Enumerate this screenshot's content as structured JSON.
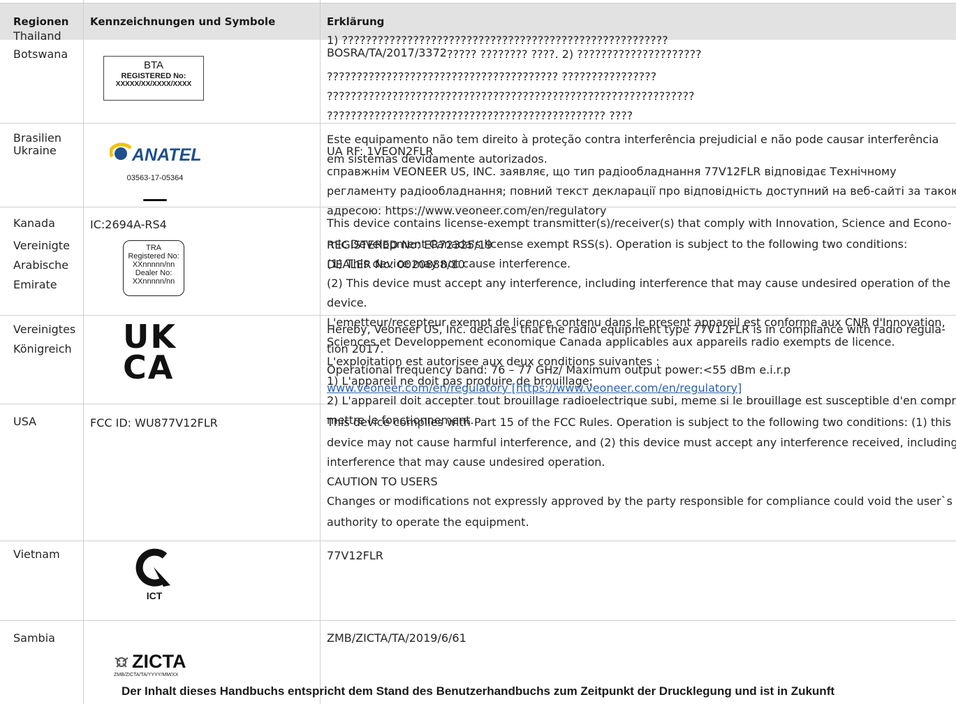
{
  "table": {
    "headers": {
      "regions": "Regionen",
      "marks": "Kennzeichnungen und Symbole",
      "explanation": "Erklärung"
    }
  },
  "rows": {
    "thailand": {
      "region": "Thailand",
      "line1": "1) ???????????????????????????????????????????????????????",
      "line1b": "BOSRA/TA/2017/3372"
    },
    "botswana": {
      "region": "Botswana",
      "logo_title": "BTA",
      "logo_line2": "REGISTERED No:",
      "logo_line3": "XXXXX/XX/XXXX/XXXX",
      "line1": "????? ???????? ????. 2) ?????????????????????",
      "line2": "??????????????????????????????????????? ????????????????",
      "line3": "??????????????????????????????????????????????????????????????",
      "line4": "??????????????????????????????????????????????? ????"
    },
    "brasilien": {
      "region": "Brasilien",
      "logo_word": "ANATEL",
      "logo_number": "03563-17-05364",
      "line1": "Este equipamento não tem direito à proteção contra interferência prejudicial e não pode causar interferência",
      "line2": "em sistemas devidamente autorizados."
    },
    "ukraine": {
      "region": "Ukraine",
      "line1": "UA RF: 1VEON2FLR",
      "line2": "справжнім VEONEER US, INC. заявляє, що тип радіообладнання 77V12FLR відповідає Технічному",
      "line3": "регламенту радіообладнання; повний текст декларації про відповідність доступний на веб-сайті за такою",
      "line4": "адресою: https://www.veoneer.com/en/regulatory"
    },
    "kanada": {
      "region": "Kanada",
      "mark": "IC:2694A-RS4",
      "line1": "This device contains license-exempt transmitter(s)/receiver(s) that comply with Innovation, Science and Econo-",
      "line2": "mic Development Canada's license exempt RSS(s). Operation is subject to the following two conditions:",
      "line3": "(1) This device may not cause interference.",
      "line4": "(2) This device must accept any interference, including interference that may cause undesired operation of the",
      "line5": "device.",
      "fr1": "L'emetteur/recepteur exempt de licence contenu dans le present appareil est conforme aux CNR d'Innovation,",
      "fr2": "Sciences et Developpement economique Canada applicables aux appareils radio exempts de licence.",
      "fr3": "L'exploitation est autorisee aux deux conditions suivantes :",
      "fr4": "1) L'appareil ne doit pas produire de brouillage;",
      "fr5": "2) L'appareil doit accepter tout brouillage radioelectrique subi, meme si le brouillage est susceptible d'en compro-",
      "fr6": "mettre le fonctionnement."
    },
    "uae": {
      "region": "Vereinigte\nArabische\nEmirate",
      "logo_title": "TRA",
      "logo_l2": "Registered No:",
      "logo_l3": "XXnnnnn/nn",
      "logo_l4": "Dealer No:",
      "logo_l5": "XXnnnnn/nn",
      "line1": "REGISTERED No: ER72325/19",
      "line2": "DEALER No: 0020888/10"
    },
    "uk": {
      "region": "Vereinigtes\nKönigreich",
      "logo_top": "UK",
      "logo_bottom": "CA",
      "line1": "Hereby, Veoneer US, Inc. declares that the radio equipment type 77V12FLR is in compliance with radio regula-",
      "line2": "tion 2017.",
      "line3": "Operational frequency band: 76 – 77 GHz/ Maximum output power:<55 dBm e.i.r.p",
      "link": "www.veoneer.com/en/regulatory [https://www.veoneer.com/en/regulatory]"
    },
    "usa": {
      "region": "USA",
      "mark": "FCC ID: WU877V12FLR",
      "line1": "This device complies with Part 15 of the FCC Rules. Operation is subject to the following two conditions: (1) this",
      "line2": "device may not cause harmful interference, and (2) this device must accept any interference received, including",
      "line3": "interference that may cause undesired operation.",
      "line4": "CAUTION TO USERS",
      "line5": "Changes or modifications not expressly approved by the party responsible for compliance could void the user`s",
      "line6": "authority to operate the equipment."
    },
    "vietnam": {
      "region": "Vietnam",
      "logo_label": "ICT",
      "line1": "77V12FLR"
    },
    "sambia": {
      "region": "Sambia",
      "logo_word": "ZICTA",
      "logo_sub": "ZMB/ZICTA/TA/YYYY/MM/XX",
      "line1": "ZMB/ZICTA/TA/2019/6/61"
    }
  },
  "footer": {
    "text": "Der Inhalt dieses Handbuchs entspricht dem Stand des Benutzerhandbuchs zum Zeitpunkt der Drucklegung und ist in Zukunft"
  }
}
